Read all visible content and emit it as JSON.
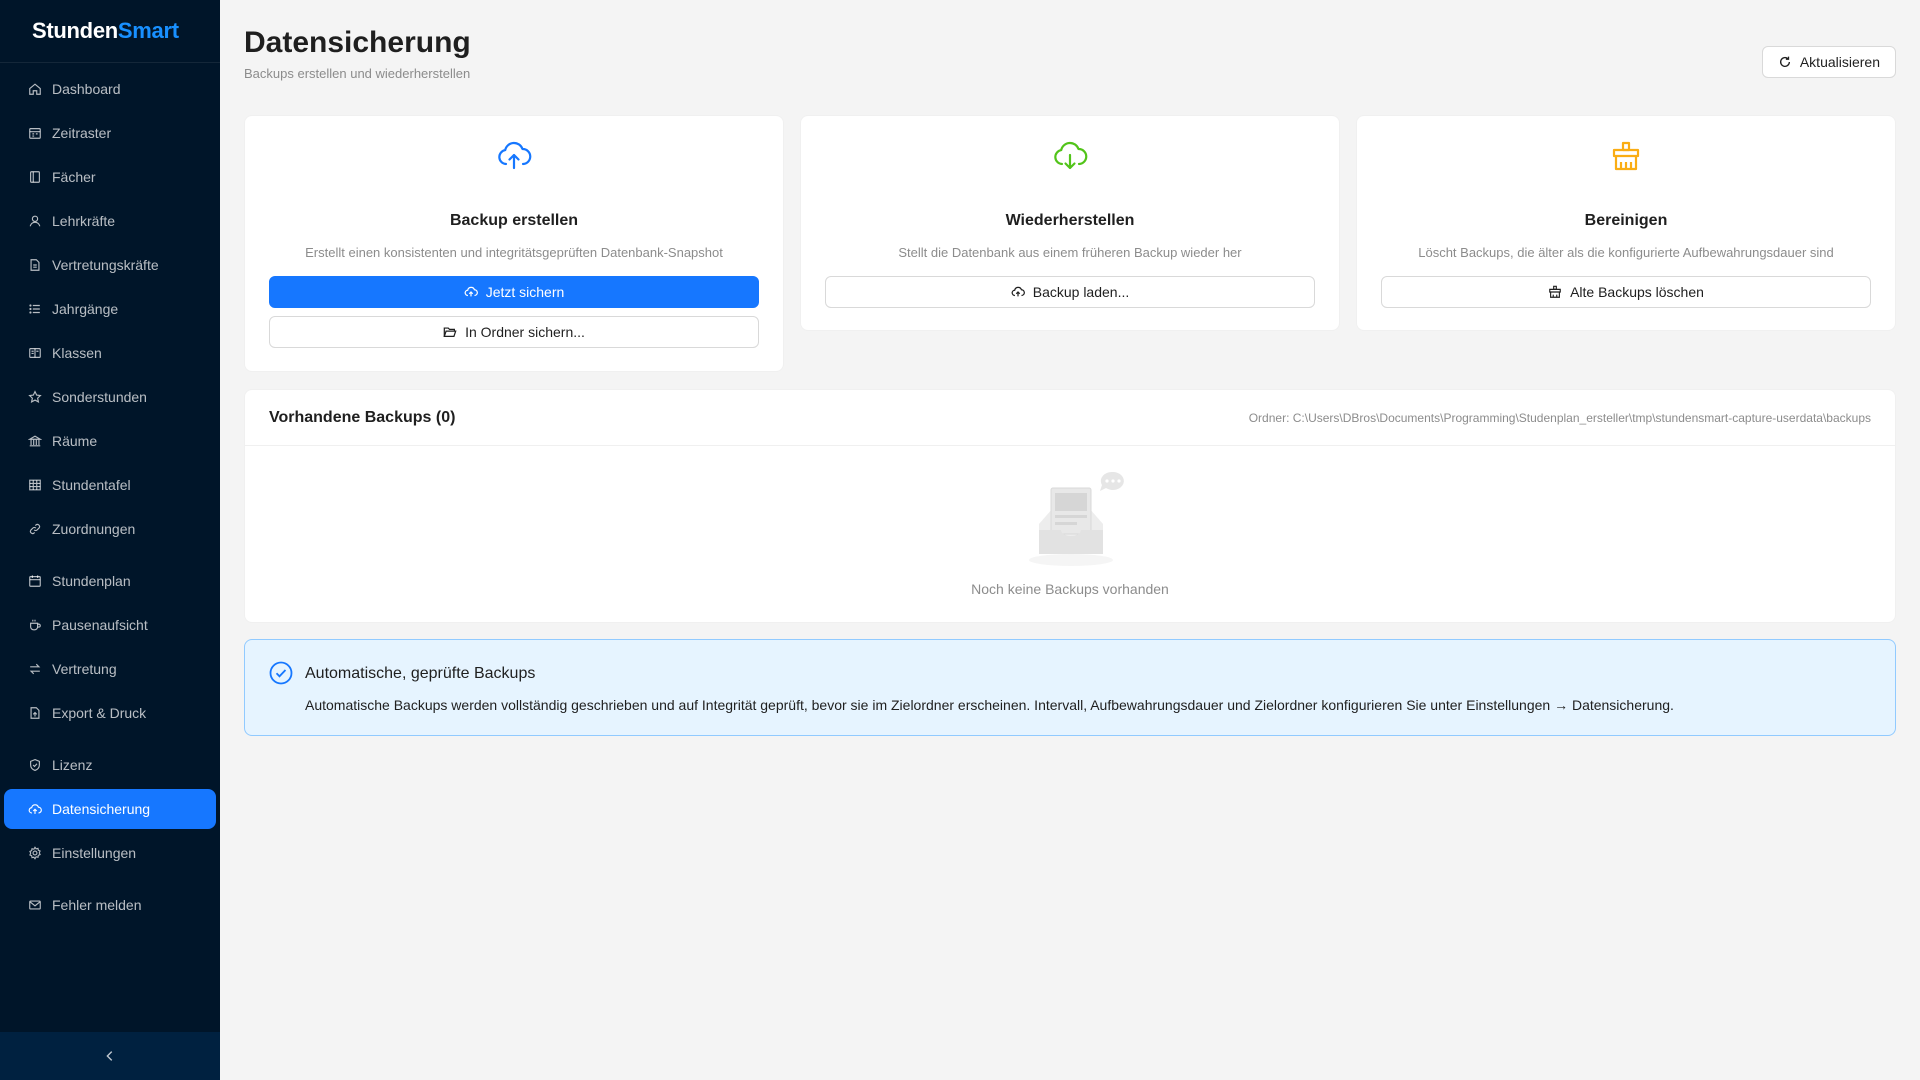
{
  "brand": {
    "part1": "Stunden",
    "part2": "Smart"
  },
  "sidebar": {
    "items": [
      {
        "label": "Dashboard",
        "icon": "home-icon"
      },
      {
        "label": "Zeitraster",
        "icon": "calendar-grid-icon"
      },
      {
        "label": "Fächer",
        "icon": "book-icon"
      },
      {
        "label": "Lehrkräfte",
        "icon": "user-icon"
      },
      {
        "label": "Vertretungskräfte",
        "icon": "document-icon"
      },
      {
        "label": "Jahrgänge",
        "icon": "list-icon"
      },
      {
        "label": "Klassen",
        "icon": "class-icon"
      },
      {
        "label": "Sonderstunden",
        "icon": "star-icon"
      },
      {
        "label": "Räume",
        "icon": "bank-icon"
      },
      {
        "label": "Stundentafel",
        "icon": "table-icon"
      },
      {
        "label": "Zuordnungen",
        "icon": "link-icon"
      },
      {
        "label": "Stundenplan",
        "icon": "calendar-icon"
      },
      {
        "label": "Pausenaufsicht",
        "icon": "coffee-icon"
      },
      {
        "label": "Vertretung",
        "icon": "swap-icon"
      },
      {
        "label": "Export & Druck",
        "icon": "export-icon"
      },
      {
        "label": "Lizenz",
        "icon": "shield-icon"
      },
      {
        "label": "Datensicherung",
        "icon": "cloud-icon"
      },
      {
        "label": "Einstellungen",
        "icon": "gear-icon"
      },
      {
        "label": "Fehler melden",
        "icon": "mail-icon"
      }
    ],
    "active": "Datensicherung",
    "collapse_icon": "chevron-left-icon"
  },
  "header": {
    "title": "Datensicherung",
    "subtitle": "Backups erstellen und wiederherstellen",
    "refresh_label": "Aktualisieren"
  },
  "cards": {
    "create": {
      "title": "Backup erstellen",
      "desc": "Erstellt einen konsistenten und integritätsgeprüften Datenbank-Snapshot",
      "primary_label": "Jetzt sichern",
      "secondary_label": "In Ordner sichern...",
      "color": "#1677ff"
    },
    "restore": {
      "title": "Wiederherstellen",
      "desc": "Stellt die Datenbank aus einem früheren Backup wieder her",
      "button_label": "Backup laden...",
      "color": "#52c41a"
    },
    "cleanup": {
      "title": "Bereinigen",
      "desc": "Löscht Backups, die älter als die konfigurierte Aufbewahrungsdauer sind",
      "button_label": "Alte Backups löschen",
      "color": "#faad14"
    }
  },
  "backups": {
    "title": "Vorhandene Backups (0)",
    "folder": "Ordner: C:\\Users\\DBros\\Documents\\Programming\\Studenplan_ersteller\\tmp\\stundensmart-capture-userdata\\backups",
    "empty_text": "Noch keine Backups vorhanden"
  },
  "info": {
    "title": "Automatische, geprüfte Backups",
    "desc": "Automatische Backups werden vollständig geschrieben und auf Integrität geprüft, bevor sie im Zielordner erscheinen. Intervall, Aufbewahrungsdauer und Zielordner konfigurieren Sie unter Einstellungen → Datensicherung.",
    "color": "#1677ff"
  }
}
